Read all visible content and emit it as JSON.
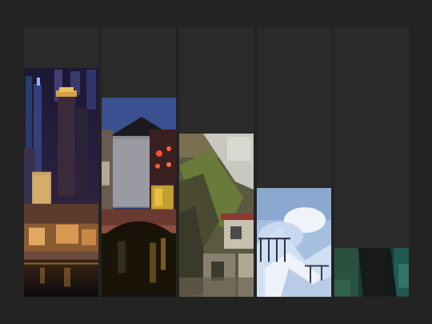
{
  "gallery": {
    "background_color": "#232323",
    "column_color": "#2a2a2a",
    "tiles": [
      {
        "subject": "night-city-skyline",
        "fill_fraction": 0.85
      },
      {
        "subject": "traditional-building-with-lanterns",
        "fill_fraction": 0.74
      },
      {
        "subject": "cliffside-stairway",
        "fill_fraction": 0.605
      },
      {
        "subject": "frozen-ice-landscape",
        "fill_fraction": 0.405
      },
      {
        "subject": "dark-forest-tree",
        "fill_fraction": 0.18
      }
    ]
  }
}
